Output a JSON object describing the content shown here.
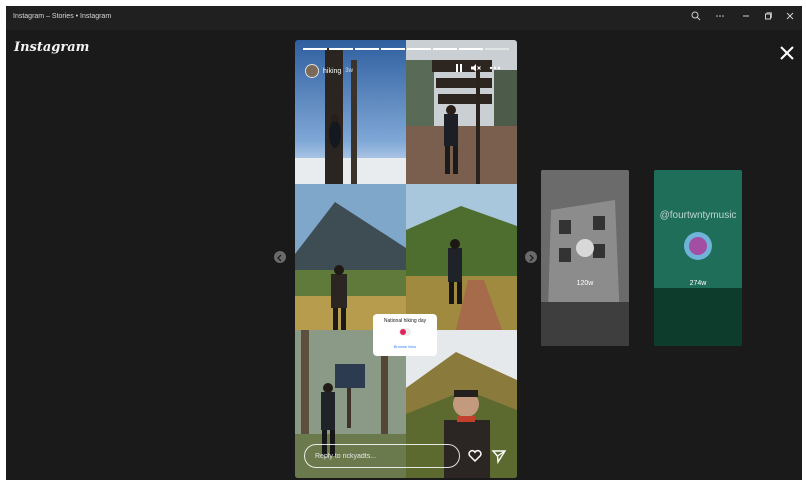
{
  "window": {
    "title": "Instagram – Stories • Instagram"
  },
  "app": {
    "logo": "Instagram"
  },
  "story": {
    "username": "hiking",
    "time": "3w",
    "progress_segments": 8,
    "progress_done": 7,
    "poll_question": "National hiking day",
    "poll_link": "Browse links",
    "reply_placeholder": "Reply to rickyadts..."
  },
  "side_stories": [
    {
      "label": "120w",
      "handle": ""
    },
    {
      "label": "274w",
      "handle": "@fourtwntymusic"
    }
  ],
  "colors": {
    "background": "#1a1a1a",
    "titlebar": "#202020",
    "poll_accent": "#e0245e"
  },
  "icons": [
    "search-icon",
    "more-icon",
    "minimize-icon",
    "restore-icon",
    "close-icon",
    "pause-icon",
    "mute-icon",
    "more-options-icon",
    "heart-icon",
    "send-icon",
    "prev-arrow-icon",
    "next-arrow-icon"
  ]
}
